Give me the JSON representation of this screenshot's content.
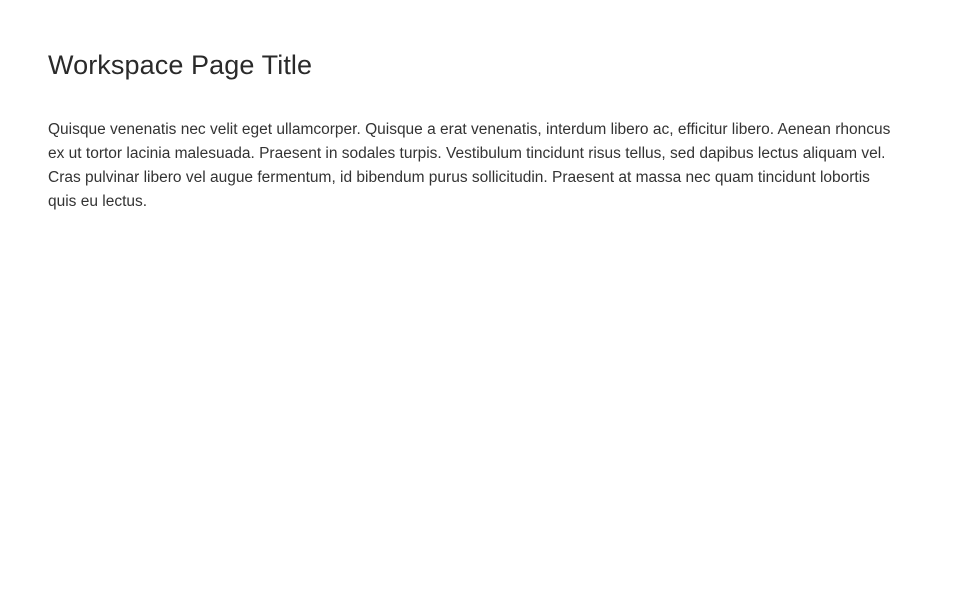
{
  "page": {
    "title": "Workspace Page Title",
    "body": "Quisque venenatis nec velit eget ullamcorper. Quisque a erat venenatis, interdum libero ac, efficitur libero. Aenean rhoncus ex ut tortor lacinia malesuada. Praesent in sodales turpis. Vestibulum tincidunt risus tellus, sed dapibus lectus aliquam vel. Cras pulvinar libero vel augue fermentum, id bibendum purus sollicitudin. Praesent at massa nec quam tincidunt lobortis quis eu lectus."
  }
}
